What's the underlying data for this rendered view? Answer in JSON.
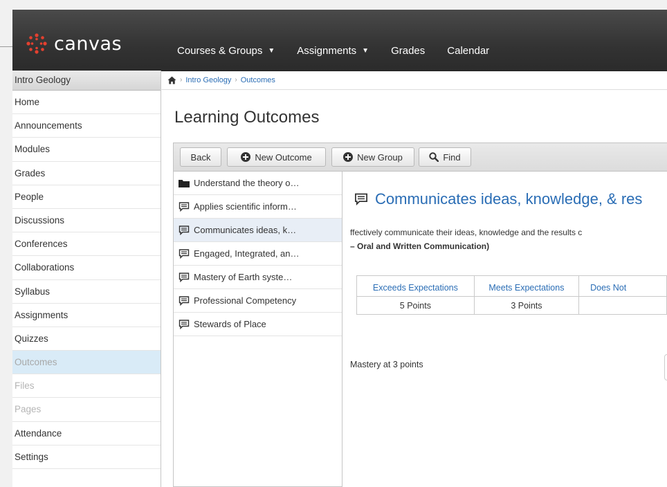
{
  "brand": {
    "name": "canvas",
    "accent": "#e4402f"
  },
  "topnav": {
    "items": [
      {
        "label": "Courses & Groups",
        "dropdown": true
      },
      {
        "label": "Assignments",
        "dropdown": true
      },
      {
        "label": "Grades",
        "dropdown": false
      },
      {
        "label": "Calendar",
        "dropdown": false
      }
    ],
    "caret": "▼"
  },
  "sidebar": {
    "course": "Intro Geology",
    "items": [
      {
        "label": "Home",
        "state": "normal"
      },
      {
        "label": "Announcements",
        "state": "normal"
      },
      {
        "label": "Modules",
        "state": "normal"
      },
      {
        "label": "Grades",
        "state": "normal"
      },
      {
        "label": "People",
        "state": "normal"
      },
      {
        "label": "Discussions",
        "state": "normal"
      },
      {
        "label": "Conferences",
        "state": "normal"
      },
      {
        "label": "Collaborations",
        "state": "normal"
      },
      {
        "label": "Syllabus",
        "state": "normal"
      },
      {
        "label": "Assignments",
        "state": "normal"
      },
      {
        "label": "Quizzes",
        "state": "normal"
      },
      {
        "label": "Outcomes",
        "state": "active"
      },
      {
        "label": "Files",
        "state": "disabled"
      },
      {
        "label": "Pages",
        "state": "disabled"
      },
      {
        "label": "Attendance",
        "state": "normal"
      },
      {
        "label": "Settings",
        "state": "normal"
      }
    ]
  },
  "breadcrumb": {
    "home_icon": "home-icon",
    "items": [
      "Intro Geology",
      "Outcomes"
    ],
    "separator": "›"
  },
  "page": {
    "title": "Learning Outcomes"
  },
  "toolbar": {
    "back": "Back",
    "new_outcome": "New Outcome",
    "new_group": "New Group",
    "find": "Find"
  },
  "outline": {
    "items": [
      {
        "label": "Understand the theory o…",
        "icon": "folder-icon",
        "selected": false
      },
      {
        "label": "Applies scientific inform…",
        "icon": "outcome-icon",
        "selected": false
      },
      {
        "label": "Communicates ideas, k…",
        "icon": "outcome-icon",
        "selected": true
      },
      {
        "label": "Engaged, Integrated, an…",
        "icon": "outcome-icon",
        "selected": false
      },
      {
        "label": "Mastery of Earth syste…",
        "icon": "outcome-icon",
        "selected": false
      },
      {
        "label": "Professional Competency",
        "icon": "outcome-icon",
        "selected": false
      },
      {
        "label": "Stewards of Place",
        "icon": "outcome-icon",
        "selected": false
      }
    ]
  },
  "detail": {
    "title": "Communicates ideas, knowledge, & res",
    "description_line1": "ffectively communicate their ideas, knowledge and the results c",
    "description_line2": "– Oral and Written Communication)",
    "rubric": [
      {
        "label": "Exceeds Expectations",
        "points": "5 Points"
      },
      {
        "label": "Meets Expectations",
        "points": "3 Points"
      },
      {
        "label": "Does Not",
        "points": ""
      }
    ],
    "mastery": "Mastery at 3 points"
  }
}
